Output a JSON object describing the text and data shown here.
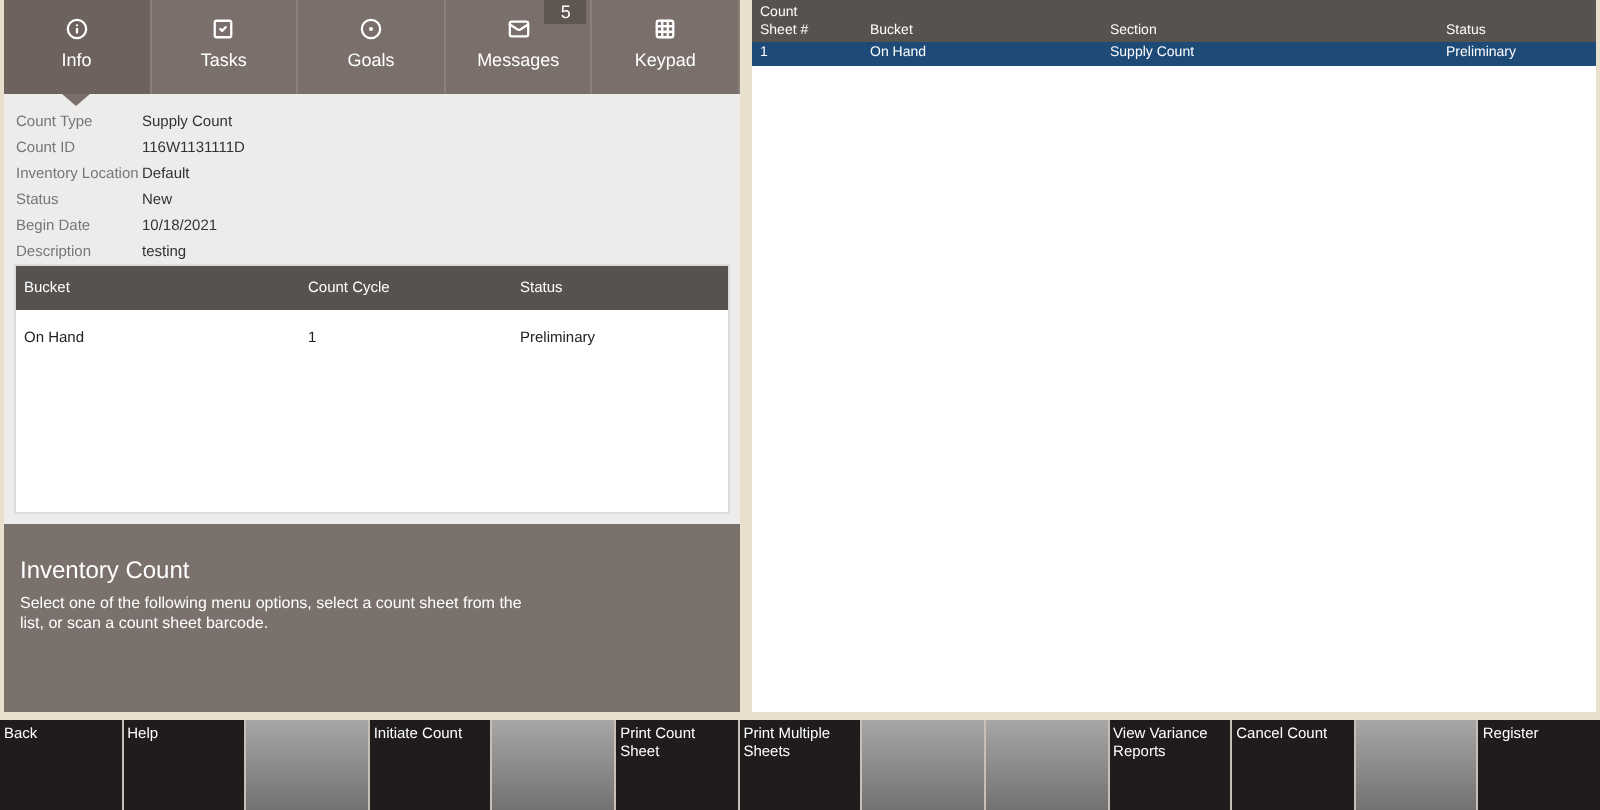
{
  "tabs": [
    {
      "label": "Info",
      "kind": "info",
      "selected": true
    },
    {
      "label": "Tasks",
      "kind": "tasks",
      "selected": false
    },
    {
      "label": "Goals",
      "kind": "goals",
      "selected": false
    },
    {
      "label": "Messages",
      "kind": "messages",
      "selected": false,
      "badge": "5"
    },
    {
      "label": "Keypad",
      "kind": "keypad",
      "selected": false
    }
  ],
  "details": [
    {
      "label": "Count Type",
      "value": "Supply Count"
    },
    {
      "label": "Count ID",
      "value": "116W1131111D"
    },
    {
      "label": "Inventory Location",
      "value": "Default"
    },
    {
      "label": "Status",
      "value": "New"
    },
    {
      "label": "Begin Date",
      "value": "10/18/2021"
    },
    {
      "label": "Description",
      "value": "testing"
    }
  ],
  "bucket_table": {
    "columns": [
      "Bucket",
      "Count Cycle",
      "Status"
    ],
    "rows": [
      [
        "On Hand",
        "1",
        "Preliminary"
      ]
    ]
  },
  "info_box": {
    "title": "Inventory Count",
    "text": "Select one of the following menu options, select a count sheet from the list, or scan a count sheet barcode."
  },
  "sheet_table": {
    "columns": [
      "Count Sheet #",
      "Bucket",
      "Section",
      "Status"
    ],
    "rows": [
      {
        "cells": [
          "1",
          "On Hand",
          "Supply Count",
          "Preliminary"
        ],
        "selected": true
      }
    ]
  },
  "buttons": [
    {
      "kind": "action",
      "label": "Back"
    },
    {
      "kind": "action",
      "label": "Help"
    },
    {
      "kind": "blank"
    },
    {
      "kind": "action",
      "label": "Initiate Count"
    },
    {
      "kind": "blank"
    },
    {
      "kind": "action",
      "label": "Print Count Sheet"
    },
    {
      "kind": "action",
      "label": "Print Multiple Sheets"
    },
    {
      "kind": "blank"
    },
    {
      "kind": "blank"
    },
    {
      "kind": "action",
      "label": "View Variance Reports"
    },
    {
      "kind": "action",
      "label": "Cancel Count"
    },
    {
      "kind": "blank"
    },
    {
      "kind": "action",
      "label": "Register"
    }
  ]
}
